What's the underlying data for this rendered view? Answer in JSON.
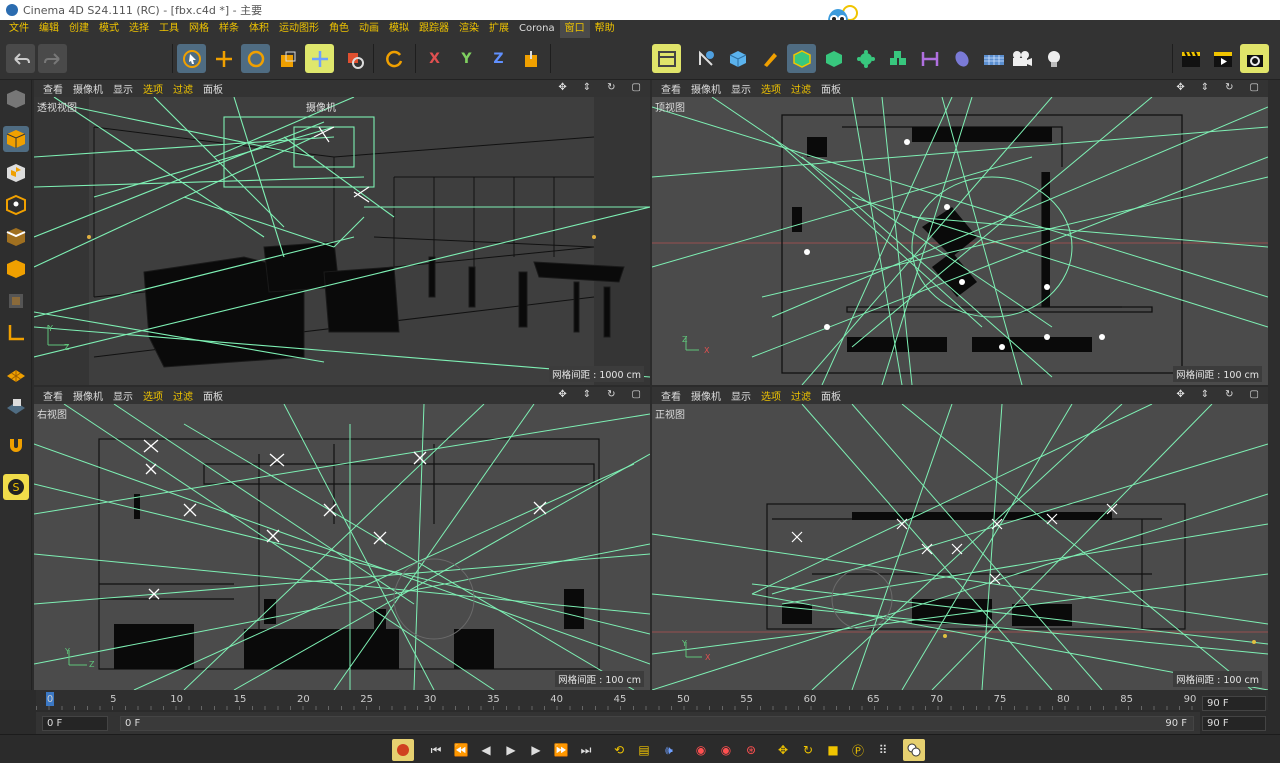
{
  "window": {
    "title": "Cinema 4D S24.111 (RC) - [fbx.c4d *] - 主要"
  },
  "menu": {
    "items": [
      {
        "label": "文件"
      },
      {
        "label": "编辑"
      },
      {
        "label": "创建"
      },
      {
        "label": "模式"
      },
      {
        "label": "选择"
      },
      {
        "label": "工具"
      },
      {
        "label": "网格"
      },
      {
        "label": "样条"
      },
      {
        "label": "体积"
      },
      {
        "label": "运动图形"
      },
      {
        "label": "角色"
      },
      {
        "label": "动画"
      },
      {
        "label": "模拟"
      },
      {
        "label": "跟踪器"
      },
      {
        "label": "渲染"
      },
      {
        "label": "扩展"
      },
      {
        "label": "Corona"
      },
      {
        "label": "窗口"
      },
      {
        "label": "帮助"
      }
    ],
    "active": "窗口"
  },
  "toolbar": {
    "icons": [
      "undo-icon",
      "redo-icon",
      "select-icon",
      "move-icon",
      "rotate-icon",
      "scale-icon",
      "live-select-icon",
      "camera-move-icon",
      "rotate-icon",
      "x-axis-icon",
      "y-axis-icon",
      "z-axis-icon",
      "coord-icon",
      "view-icon",
      "spline-pen-icon",
      "cube-icon",
      "pen-icon",
      "polygon-icon",
      "array-icon",
      "deformer-icon",
      "cloner-icon",
      "symmetry-icon",
      "field-icon",
      "floor-icon",
      "camera-icon",
      "light-icon",
      "clapper-icon",
      "render-view-icon",
      "render-settings-icon"
    ],
    "axis_labels": {
      "x": "X",
      "y": "Y",
      "z": "Z"
    }
  },
  "viewport_menu": [
    "查看",
    "摄像机",
    "显示",
    "选项",
    "过滤",
    "面板"
  ],
  "viewports": {
    "perspective": {
      "label": "透视视图",
      "camera": "摄像机",
      "grid": "网格间距 : 1000 cm"
    },
    "top": {
      "label": "顶视图",
      "grid": "网格间距 : 100 cm"
    },
    "right": {
      "label": "右视图",
      "grid": "网格间距 : 100 cm"
    },
    "front": {
      "label": "正视图",
      "grid": "网格间距 : 100 cm"
    }
  },
  "axes": {
    "x": "X",
    "y": "Y",
    "z": "Z"
  },
  "timeline": {
    "ticks": [
      "0",
      "5",
      "10",
      "15",
      "20",
      "25",
      "30",
      "35",
      "40",
      "45",
      "50",
      "55",
      "60",
      "65",
      "70",
      "75",
      "80",
      "85",
      "90"
    ],
    "current_frame": "0 F",
    "start_frame": "0 F",
    "end_frame_field": "90 F",
    "range_end": "90 F",
    "max_frame": "90 F"
  },
  "colors": {
    "accent": "#f0c400",
    "selected": "#4f6c82",
    "lines": "#7ef0b4",
    "viewport_bg": "#4b4b4b"
  }
}
